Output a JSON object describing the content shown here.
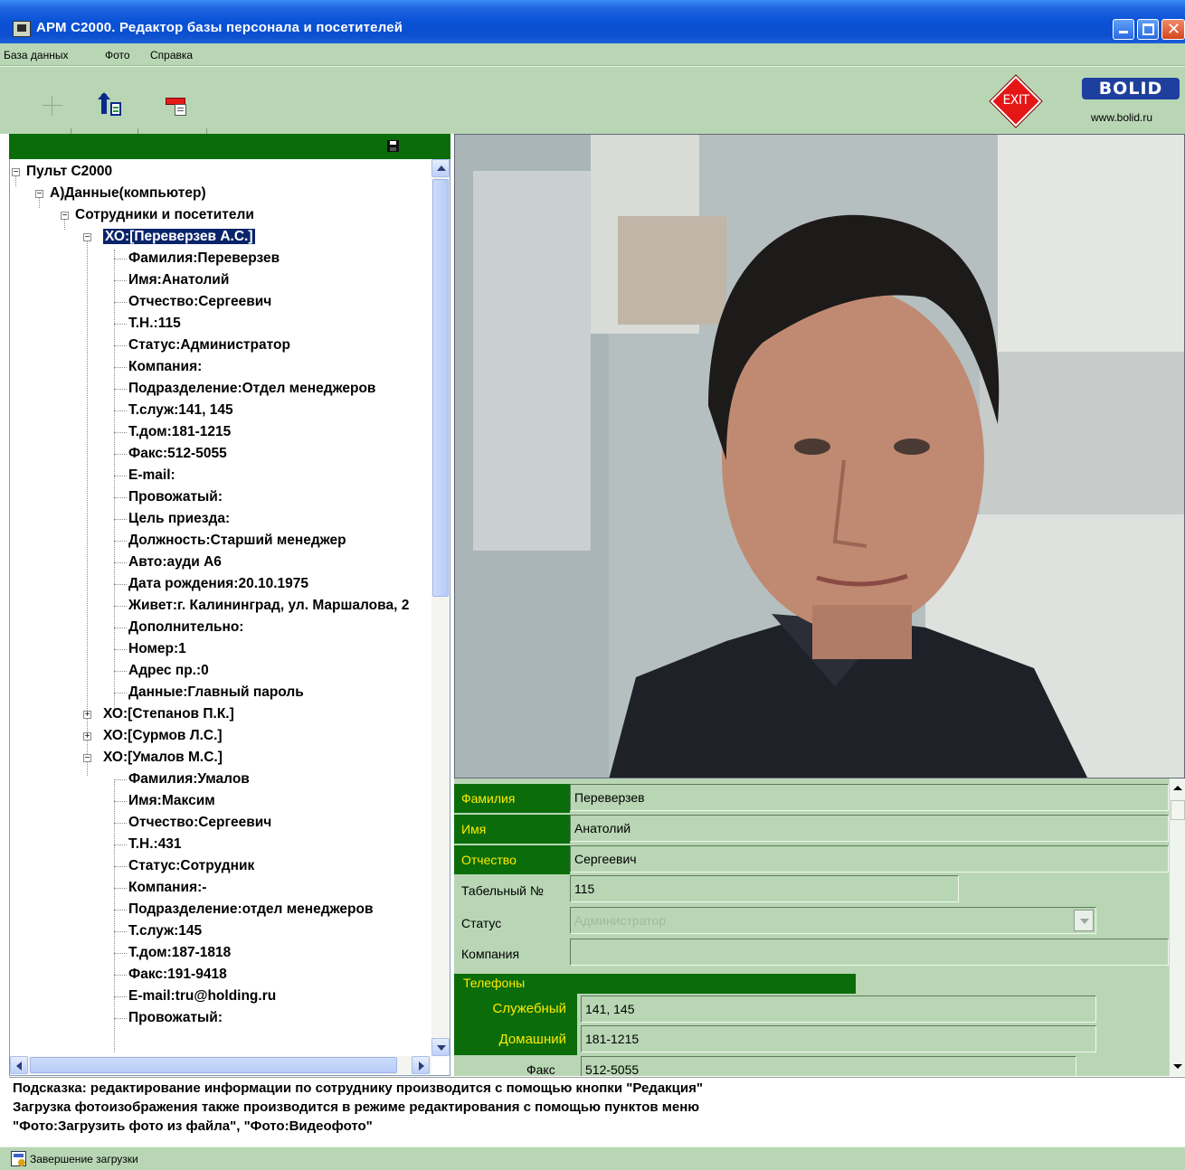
{
  "window": {
    "title": "АРМ С2000. Редактор базы персонала и посетителей",
    "minimize_icon": "minimize-icon",
    "maximize_icon": "maximize-icon",
    "close_icon": "close-icon"
  },
  "menu": [
    "База данных",
    "Фото",
    "Справка"
  ],
  "toolbar": {
    "exit_label": "EXIT",
    "logo_text": "BOLID",
    "logo_url": "www.bolid.ru"
  },
  "tree": {
    "root": "Пульт С2000",
    "data_node": "А)Данные(компьютер)",
    "group": "Сотрудники и посетители",
    "selected_person": "ХО:[Переверзев А.С.]",
    "person1_fields": [
      "Фамилия:Переверзев",
      "Имя:Анатолий",
      "Отчество:Сергеевич",
      "Т.Н.:115",
      "Статус:Администратор",
      "Компания:",
      "Подразделение:Отдел менеджеров",
      "Т.служ:141, 145",
      "Т.дом:181-1215",
      "Факс:512-5055",
      "E-mail:",
      "Провожатый:",
      "Цель приезда:",
      "Должность:Старший менеджер",
      "Авто:ауди А6",
      "Дата рождения:20.10.1975",
      "Живет:г. Калининград, ул. Маршалова, 2",
      "Дополнительно:",
      "Номер:1",
      "Адрес пр.:0",
      "Данные:Главный пароль"
    ],
    "person2": "ХО:[Степанов П.К.]",
    "person3": "ХО:[Сурмов Л.С.]",
    "person4": "ХО:[Умалов М.С.]",
    "person4_fields": [
      "Фамилия:Умалов",
      "Имя:Максим",
      "Отчество:Сергеевич",
      "Т.Н.:431",
      "Статус:Сотрудник",
      "Компания:-",
      "Подразделение:отдел менеджеров",
      "Т.служ:145",
      "Т.дом:187-1818",
      "Факс:191-9418",
      "E-mail:tru@holding.ru",
      "Провожатый:"
    ]
  },
  "form": {
    "surname_label": "Фамилия",
    "surname_value": "Переверзев",
    "name_label": "Имя",
    "name_value": "Анатолий",
    "patronymic_label": "Отчество",
    "patronymic_value": "Сергеевич",
    "tabnum_label": "Табельный №",
    "tabnum_value": "115",
    "status_label": "Статус",
    "status_value": "Администратор",
    "company_label": "Компания",
    "company_value": "",
    "phones_header": "Телефоны",
    "work_label": "Служебный",
    "work_value": "141, 145",
    "home_label": "Домашний",
    "home_value": "181-1215",
    "fax_label": "Факс",
    "fax_value": "512-5055"
  },
  "hint": [
    "Подсказка: редактирование информации по сотруднику производится с помощью кнопки \"Редакция\"",
    "Загрузка фотоизображения также производится в режиме редактирования с помощью пунктов меню",
    "\"Фото:Загрузить фото из файла\", \"Фото:Видеофото\""
  ],
  "status": "Завершение загрузки",
  "colors": {
    "panel_green": "#b8d6b4",
    "dark_green": "#0a6d0a",
    "label_yellow": "#ffea00",
    "titlebar_blue": "#0a52d6",
    "selection_blue": "#0a246a"
  }
}
